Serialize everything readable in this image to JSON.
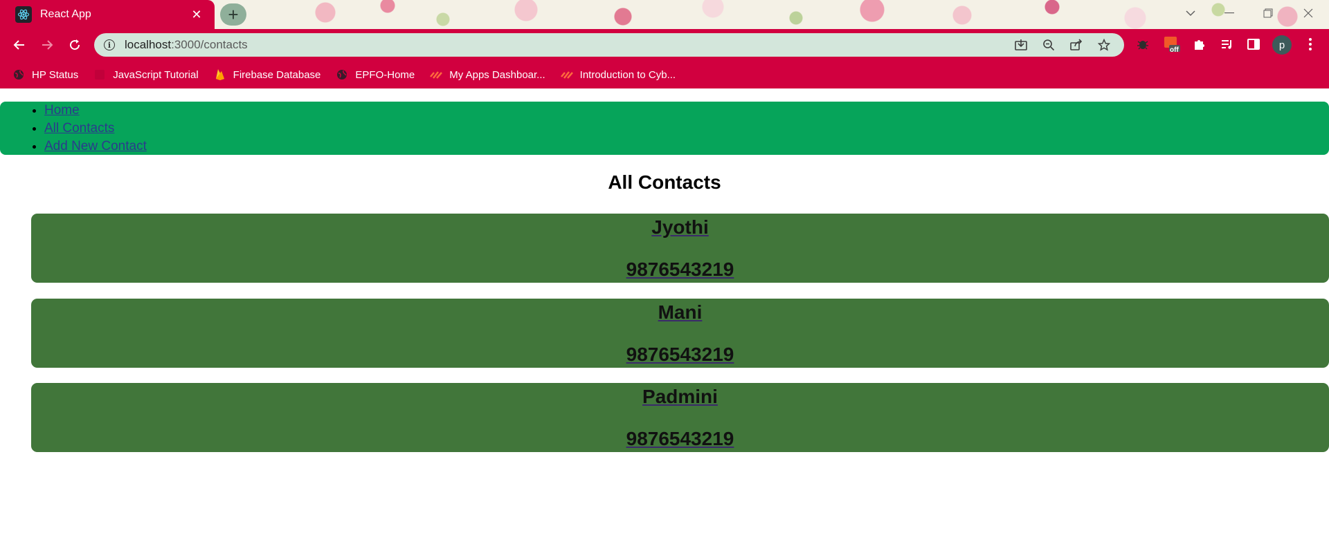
{
  "browser": {
    "tab_title": "React App",
    "url_host": "localhost",
    "url_path": ":3000/contacts",
    "avatar_letter": "p",
    "extension_badge": "off"
  },
  "bookmarks": [
    {
      "label": "HP Status",
      "icon": "globe-icon"
    },
    {
      "label": "JavaScript Tutorial",
      "icon": "w3-icon"
    },
    {
      "label": "Firebase Database",
      "icon": "firebase-icon"
    },
    {
      "label": "EPFO-Home",
      "icon": "globe-icon"
    },
    {
      "label": "My Apps Dashboar...",
      "icon": "apps-icon"
    },
    {
      "label": "Introduction to Cyb...",
      "icon": "apps-icon"
    }
  ],
  "nav": {
    "items": [
      {
        "label": "Home"
      },
      {
        "label": "All Contacts"
      },
      {
        "label": "Add New Contact"
      }
    ]
  },
  "page": {
    "title": "All Contacts"
  },
  "contacts": [
    {
      "name": "Jyothi",
      "phone": "9876543219"
    },
    {
      "name": "Mani",
      "phone": "9876543219"
    },
    {
      "name": "Padmini",
      "phone": "9876543219"
    }
  ],
  "colors": {
    "browser_accent": "#d1003f",
    "nav_bg": "#06a45a",
    "card_bg": "#41763a"
  }
}
